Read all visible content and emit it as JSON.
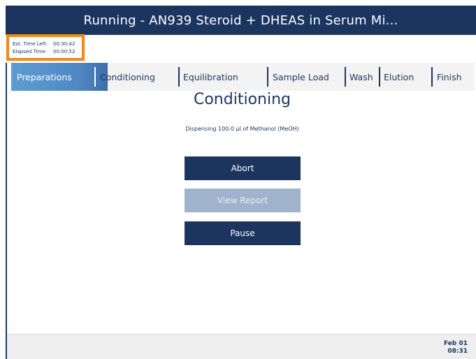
{
  "header": {
    "title": "Running - AN939 Steroid + DHEAS in Serum Mi..."
  },
  "timer": {
    "est_label": "Est. Time Left:",
    "est_value": "00:30:42",
    "elapsed_label": "Elapsed Time:",
    "elapsed_value": "00:00:52"
  },
  "steps": {
    "items": [
      {
        "label": "Preparations"
      },
      {
        "label": "Conditioning"
      },
      {
        "label": "Equilibration"
      },
      {
        "label": "Sample Load"
      },
      {
        "label": "Wash"
      },
      {
        "label": "Elution"
      },
      {
        "label": "Finish"
      }
    ],
    "active_index": 0
  },
  "main": {
    "section_title": "Conditioning",
    "status": "Dispensing 100.0 µl of Methanol (MeOH)"
  },
  "actions": {
    "abort_label": "Abort",
    "report_label": "View Report",
    "pause_label": "Pause"
  },
  "footer": {
    "date": "Feb 01",
    "time": "08:31"
  },
  "colors": {
    "primary": "#1b355f",
    "progress": "#4f88c4",
    "highlight": "#f08a1c",
    "disabled": "#9fb3cc"
  }
}
